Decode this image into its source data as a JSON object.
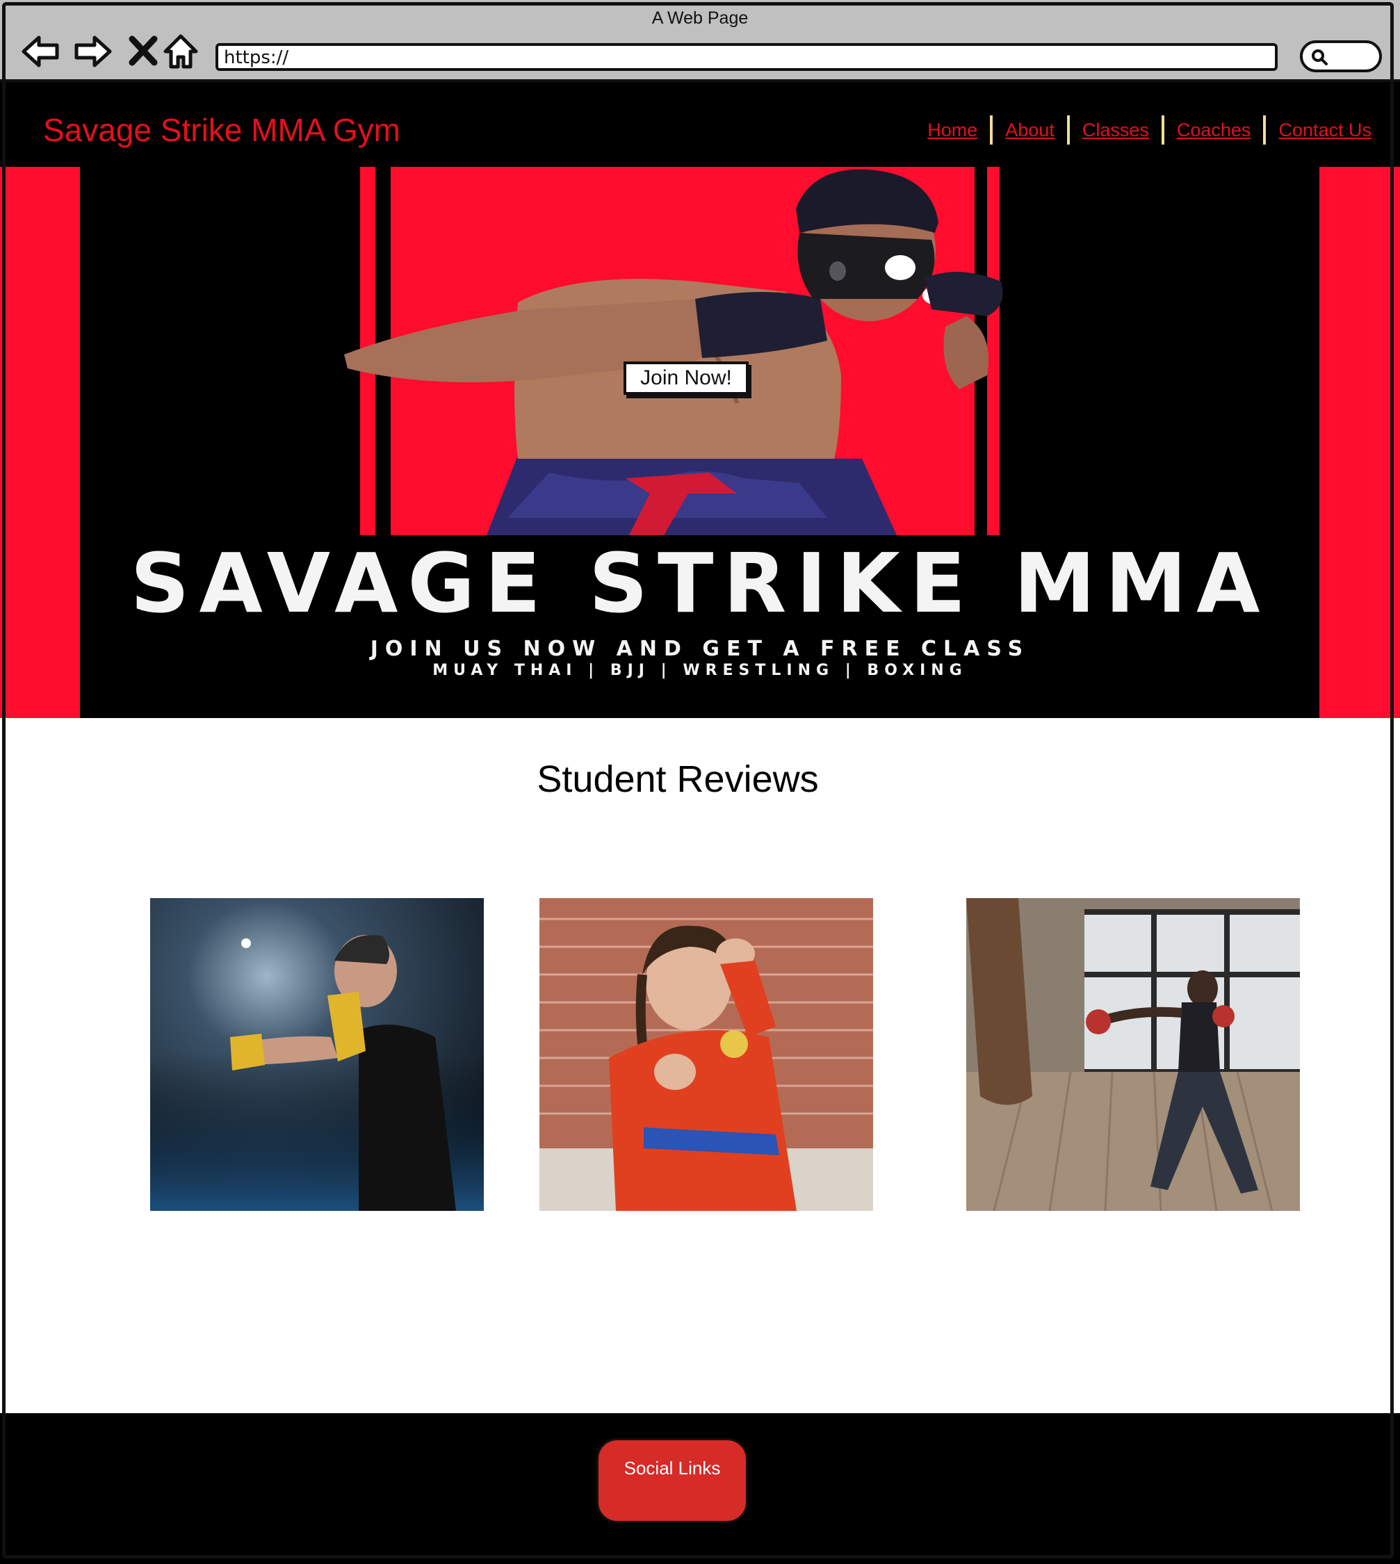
{
  "browser": {
    "window_title": "A Web Page",
    "url": "https://"
  },
  "header": {
    "brand": "Savage Strike MMA Gym",
    "nav": [
      "Home",
      "About",
      "Classes",
      "Coaches",
      "Contact Us"
    ],
    "brand_color": "#e3101c",
    "separator_color": "#f0df96"
  },
  "hero": {
    "title": "SAVAGE STRIKE MMA",
    "subtitle": "JOIN US NOW AND GET A FREE CLASS",
    "disciplines": "MUAY THAI    |  BJJ  |    WRESTLING   |    BOXING",
    "cta": "Join Now!",
    "accent_color": "#ff0c2e"
  },
  "reviews": {
    "heading": "Student Reviews",
    "images": [
      "boxer-in-spotlight-photo",
      "kid-in-red-karate-gi-photo",
      "woman-punching-heavy-bag-photo"
    ]
  },
  "footer": {
    "social_button": "Social Links",
    "button_color": "#d62b27"
  }
}
